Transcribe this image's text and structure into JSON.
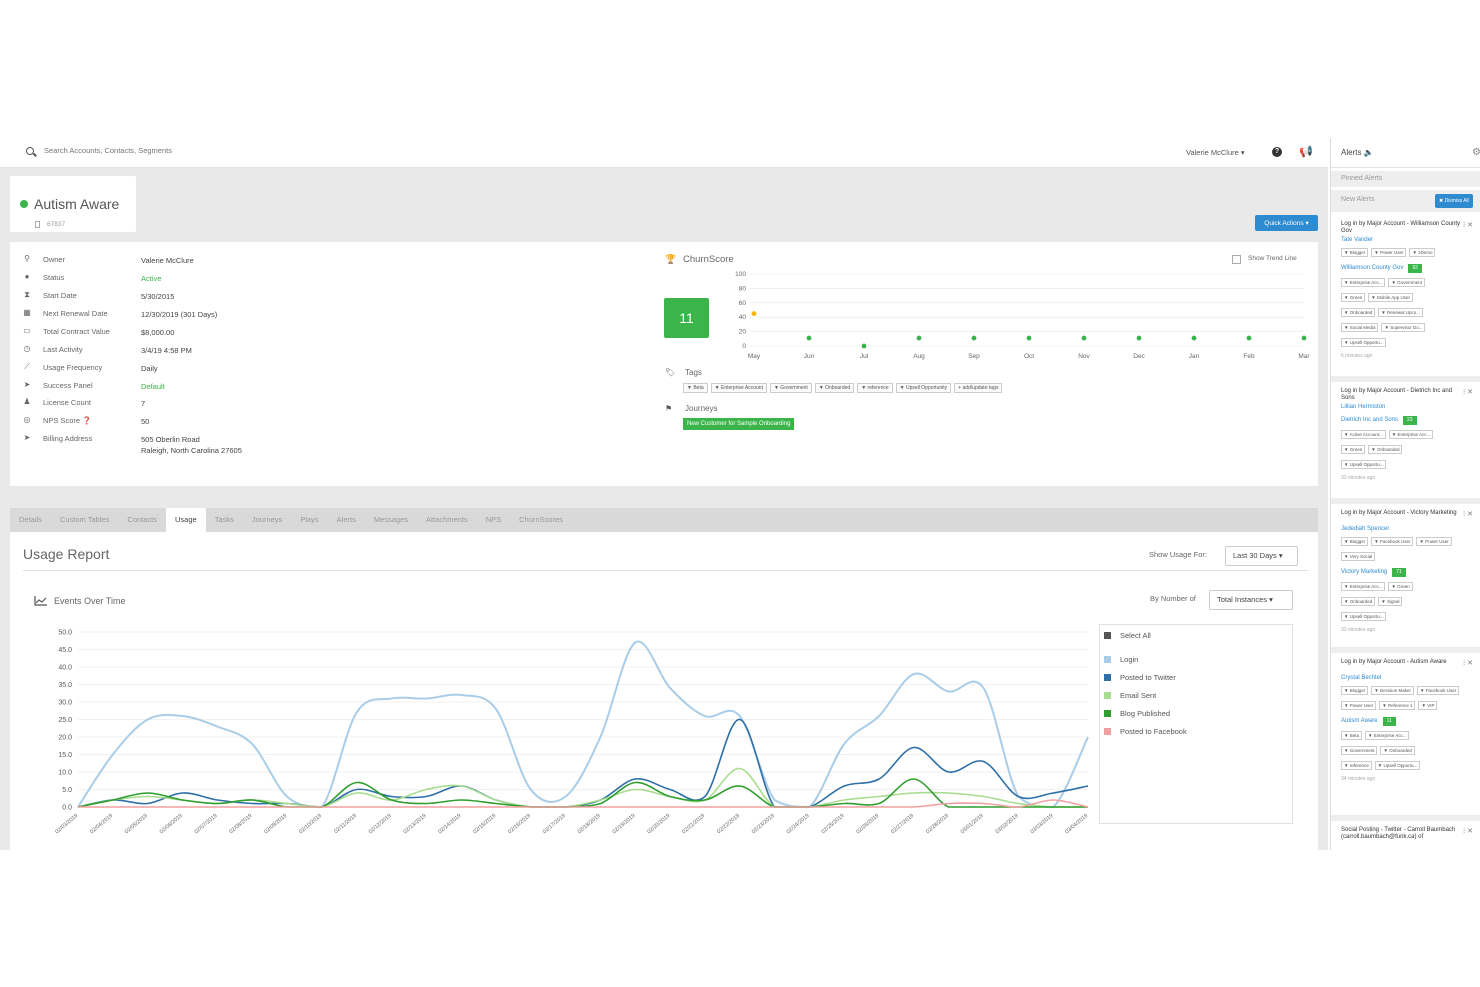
{
  "topbar": {
    "search_placeholder": "Search Accounts, Contacts, Segments",
    "user_menu": "Valerie McClure ▾"
  },
  "account": {
    "name": "Autism Aware",
    "id": "67837",
    "quick_actions": "Quick Actions ▾"
  },
  "properties": [
    {
      "label": "Owner",
      "value": "Valerie McClure",
      "icon": "key-icon",
      "glyph": "⚲",
      "style": "bold"
    },
    {
      "label": "Status",
      "value": "Active",
      "icon": "info-icon",
      "glyph": "●",
      "style": "green"
    },
    {
      "label": "Start Date",
      "value": "5/30/2015",
      "icon": "hourglass-icon",
      "glyph": "⧗",
      "style": "plain"
    },
    {
      "label": "Next Renewal Date",
      "value": "12/30/2019 (301 Days)",
      "icon": "calendar-icon",
      "glyph": "▦",
      "style": "plain"
    },
    {
      "label": "Total Contract Value",
      "value": "$8,000.00",
      "icon": "money-icon",
      "glyph": "▭",
      "style": "plain"
    },
    {
      "label": "Last Activity",
      "value": "3/4/19 4:58 PM",
      "icon": "clock-icon",
      "glyph": "◷",
      "style": "plain"
    },
    {
      "label": "Usage Frequency",
      "value": "Daily",
      "icon": "line-chart-icon",
      "glyph": "⟋",
      "style": "plain"
    },
    {
      "label": "Success Panel",
      "value": "Default",
      "icon": "send-icon",
      "glyph": "➤",
      "style": "green"
    },
    {
      "label": "License Count",
      "value": "7",
      "icon": "user-icon",
      "glyph": "♟",
      "style": "plain"
    },
    {
      "label": "NPS Score ❓",
      "value": "50",
      "icon": "nps-icon",
      "glyph": "◎",
      "style": "plain"
    },
    {
      "label": "Billing Address",
      "value": "505 Oberlin Road",
      "value2": "Raleigh, North Carolina 27605",
      "icon": "location-icon",
      "glyph": "➤",
      "style": "plain"
    }
  ],
  "churn": {
    "title": "ChurnScore",
    "show_trend_line": "Show Trend Line",
    "score": "11",
    "y_ticks": [
      "100",
      "80",
      "60",
      "40",
      "20",
      "0"
    ],
    "months": [
      "May",
      "Jun",
      "Jul",
      "Aug",
      "Sep",
      "Oct",
      "Nov",
      "Dec",
      "Jan",
      "Feb",
      "Mar"
    ],
    "values": [
      45,
      11,
      0,
      11,
      11,
      11,
      11,
      11,
      11,
      11,
      11
    ],
    "colors": {
      "point": "#3bb54a",
      "first_point": "#f5b400",
      "grid": "#e8e8e8"
    }
  },
  "tags": {
    "label": "Tags",
    "items": [
      "Beta",
      "Enterprise Account",
      "Government",
      "Onboarded",
      "reference",
      "Upsell Opportunity",
      "+ add/update tags"
    ]
  },
  "journeys": {
    "label": "Journeys",
    "items": [
      "New Customer for Sample Onboarding"
    ]
  },
  "tabs": [
    "Details",
    "Custom Tables",
    "Contacts",
    "Usage",
    "Tasks",
    "Journeys",
    "Plays",
    "Alerts",
    "Messages",
    "Attachments",
    "NPS",
    "ChurnScores"
  ],
  "active_tab": "Usage",
  "usage": {
    "title": "Usage Report",
    "show_usage_for": "Show Usage For:",
    "range": "Last 30 Days ▾",
    "events_title": "Events Over Time",
    "by_number_of": "By Number of",
    "count_type": "Total Instances ▾"
  },
  "chart_data": {
    "type": "line",
    "title": "Events Over Time",
    "ylim": [
      0,
      50
    ],
    "y_ticks": [
      "50.0",
      "45.0",
      "40.0",
      "35.0",
      "30.0",
      "25.0",
      "20.0",
      "15.0",
      "10.0",
      "5.0",
      "0.0"
    ],
    "x": [
      "02/03/2019",
      "02/04/2019",
      "02/05/2019",
      "02/06/2019",
      "02/07/2019",
      "02/08/2019",
      "02/09/2019",
      "02/10/2019",
      "02/11/2019",
      "02/12/2019",
      "02/13/2019",
      "02/14/2019",
      "02/15/2019",
      "02/16/2019",
      "02/17/2019",
      "02/18/2019",
      "02/19/2019",
      "02/20/2019",
      "02/21/2019",
      "02/22/2019",
      "02/23/2019",
      "02/24/2019",
      "02/25/2019",
      "02/26/2019",
      "02/27/2019",
      "02/28/2019",
      "03/01/2019",
      "03/02/2019",
      "03/03/2019",
      "03/04/2019"
    ],
    "legend_header": "Select All",
    "series": [
      {
        "name": "Login",
        "color": "#a9cde8",
        "values": [
          0,
          15,
          25,
          26,
          23,
          18,
          3,
          0,
          27,
          31,
          31,
          32,
          28,
          5,
          3,
          20,
          47,
          34,
          26,
          26,
          2,
          0,
          18,
          26,
          38,
          33,
          34,
          3,
          0,
          20
        ]
      },
      {
        "name": "Posted to Twitter",
        "color": "#2e6fa8",
        "values": [
          0,
          2,
          1,
          4,
          2,
          1,
          1,
          0,
          5,
          3,
          3,
          6,
          2,
          0,
          0,
          2,
          8,
          5,
          3,
          25,
          0,
          0,
          6,
          8,
          17,
          10,
          13,
          3,
          4,
          6
        ]
      },
      {
        "name": "Email Sent",
        "color": "#a8dc8e",
        "values": [
          0,
          2,
          3,
          2,
          1,
          2,
          1,
          0,
          4,
          2,
          5,
          6,
          2,
          0,
          0,
          2,
          5,
          3,
          2,
          11,
          0,
          0,
          2,
          3,
          4,
          4,
          3,
          1,
          0,
          0
        ]
      },
      {
        "name": "Blog Published",
        "color": "#2f9e2f",
        "values": [
          0,
          2,
          4,
          2,
          1,
          2,
          0,
          0,
          7,
          2,
          1,
          2,
          1,
          0,
          0,
          1,
          7,
          3,
          2,
          6,
          0,
          0,
          1,
          1,
          8,
          0,
          0,
          0,
          0,
          0
        ]
      },
      {
        "name": "Posted to Facebook",
        "color": "#f0a0a0",
        "values": [
          0,
          0,
          0,
          0,
          0,
          0,
          0,
          0,
          0,
          0,
          0,
          0,
          0,
          0,
          0,
          0,
          0,
          0,
          0,
          0,
          0,
          0,
          0,
          0,
          0,
          1,
          1,
          0,
          2,
          0
        ]
      }
    ]
  },
  "alerts": {
    "title": "Alerts 🔈",
    "pinned": "Pinned Alerts",
    "new_alerts": "New Alerts",
    "dismiss_all": "✖ Dismiss All",
    "items": [
      {
        "title": "Log in by Major Account - Williamson County Gov",
        "contact": "Tate Vander",
        "contact_tags": [
          "Blogger",
          "Power User",
          "zDemo"
        ],
        "account": "Williamson County Gov",
        "score": "92",
        "account_tags": [
          [
            "Enterprise Acc...",
            "Government"
          ],
          [
            "Green",
            "Mobile App User"
          ],
          [
            "Onboarded",
            "Renewal Upco..."
          ],
          [
            "Social Media",
            "Supervisor Do..."
          ],
          [
            "Upsell Opportu..."
          ]
        ],
        "time": "6 minutes ago"
      },
      {
        "title": "Log in by Major Account - Dietrich Inc and Sons",
        "contact": "Lillian Hermiston",
        "contact_tags": [],
        "account": "Dietrich Inc and Sons",
        "score": "23",
        "account_tags": [
          [
            "Active Account...",
            "Enterprise Acc..."
          ],
          [
            "Green",
            "Onboarded"
          ],
          [
            "Upsell Opportu..."
          ]
        ],
        "time": "33 minutes ago"
      },
      {
        "title": "Log in by Major Account - Victory Marketing",
        "contact": "Jedediah Spencer",
        "contact_tags": [
          "Blogger",
          "Facebook User",
          "Power User",
          "Very Social"
        ],
        "account": "Victory Marketing",
        "score": "71",
        "account_tags": [
          [
            "Enterprise Acc...",
            "Green"
          ],
          [
            "Onboarded",
            "Signal"
          ],
          [
            "Upsell Opportu..."
          ]
        ],
        "time": "33 minutes ago"
      },
      {
        "title": "Log in by Major Account - Autism Aware",
        "contact": "Crystal Bechtel",
        "contact_tags": [
          "Blogger",
          "Decision Maker",
          "Facebook User",
          "Power User",
          "Reference 1",
          "VIP"
        ],
        "account": "Autism Aware",
        "score": "11",
        "account_tags": [
          [
            "Beta",
            "Enterprise Acc..."
          ],
          [
            "Government",
            "Onboarded"
          ],
          [
            "reference",
            "Upsell Opportu..."
          ]
        ],
        "time": "34 minutes ago"
      },
      {
        "title": "Social Posting - Twitter - Carroll Baumbach (carroll.baumbach@funk.ca) of",
        "contact": "",
        "contact_tags": [],
        "account": "",
        "score": "",
        "account_tags": [],
        "time": ""
      }
    ]
  }
}
